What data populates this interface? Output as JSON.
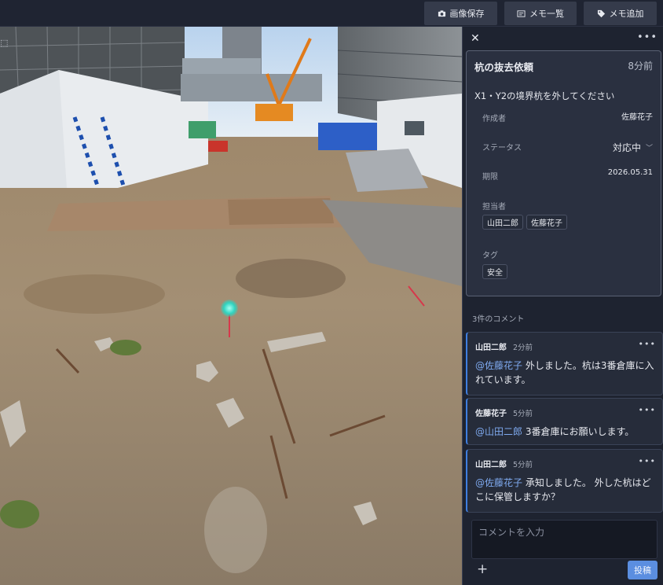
{
  "toolbar": {
    "save_image": {
      "label": "画像保存",
      "icon": "camera-icon"
    },
    "memo_list": {
      "label": "メモ一覧",
      "icon": "list-icon"
    },
    "add_memo": {
      "label": "メモ追加",
      "icon": "tag-icon"
    }
  },
  "panel": {
    "task": {
      "title": "杭の抜去依頼",
      "time_ago": "8分前",
      "description": "X1・Y2の境界杭を外してください",
      "creator_label": "作成者",
      "creator": "佐藤花子",
      "status_label": "ステータス",
      "status": "対応中",
      "due_label": "期限",
      "due": "2026.05.31",
      "assignees_label": "担当者",
      "assignees": [
        "山田二郎",
        "佐藤花子"
      ],
      "tags_label": "タグ",
      "tags": [
        "安全"
      ]
    },
    "comments_count": "3件のコメント",
    "comments": [
      {
        "author": "山田二郎",
        "time": "2分前",
        "mention": "@佐藤花子",
        "text": " 外しました。杭は3番倉庫に入れています。"
      },
      {
        "author": "佐藤花子",
        "time": "5分前",
        "mention": "@山田二郎",
        "text": " 3番倉庫にお願いします。"
      },
      {
        "author": "山田二郎",
        "time": "5分前",
        "mention": "@佐藤花子",
        "text": " 承知しました。 外した杭はどこに保管しますか？"
      }
    ],
    "comment_placeholder": "コメントを入力",
    "post_label": "投稿"
  },
  "colors": {
    "accent": "#5b8ee0",
    "mention": "#7faaf0",
    "pin": "#2fd3bf",
    "panel_bg": "#1e2330",
    "card_bg": "#2a3040"
  }
}
